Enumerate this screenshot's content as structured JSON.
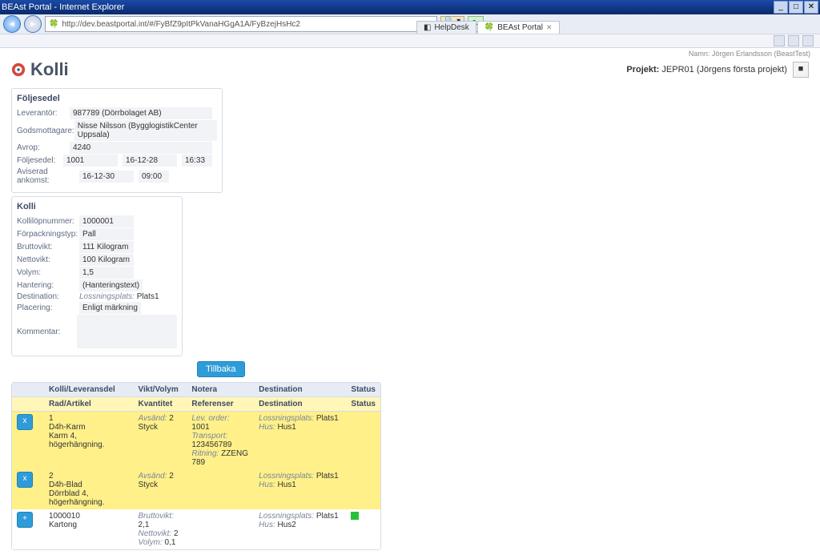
{
  "window": {
    "title": "BEAst Portal - Internet Explorer"
  },
  "url": "http://dev.beastportal.int/#/FyBfZ9pItPkVanaHGgA1A/FyBzejHsHc2",
  "tabs": [
    {
      "label": "HelpDesk",
      "active": false
    },
    {
      "label": "BEAst Portal",
      "active": true
    }
  ],
  "user_line": "Namn: Jörgen Erlandsson (BeastTest)",
  "page_title": "Kolli",
  "projekt_label": "Projekt:",
  "projekt_value": "JEPR01 (Jörgens första projekt)",
  "foljesedel": {
    "title": "Följesedel",
    "leverantor_label": "Leverantör:",
    "leverantor": "987789 (Dörrbolaget AB)",
    "godsmottagare_label": "Godsmottagare:",
    "godsmottagare": "Nisse Nilsson (BygglogistikCenter Uppsala)",
    "avrop_label": "Avrop:",
    "avrop": "4240",
    "foljesedel_label": "Följesedel:",
    "foljesedel": "1001",
    "foljesedel_date": "16-12-28",
    "foljesedel_time": "16:33",
    "aviserad_label": "Aviserad ankomst:",
    "aviserad_date": "16-12-30",
    "aviserad_time": "09:00"
  },
  "kolli": {
    "title": "Kolli",
    "kollilop_label": "Kollilöpnummer:",
    "kollilop": "1000001",
    "forpack_label": "Förpackningstyp:",
    "forpack": "Pall",
    "brutto_label": "Bruttovikt:",
    "brutto": "111 Kilogram",
    "netto_label": "Nettovikt:",
    "netto": "100 Kilogram",
    "volym_label": "Volym:",
    "volym": "1,5",
    "hantering_label": "Hantering:",
    "hantering": "(Hanteringstext)",
    "destination_label": "Destination:",
    "destination_prefix": "Lossningsplats:",
    "destination": "Plats1",
    "placering_label": "Placering:",
    "placering": "Enligt märkning",
    "kommentar_label": "Kommentar:"
  },
  "back_button": "Tillbaka",
  "table": {
    "headers1": [
      "",
      "Kolli/Leveransdel",
      "Vikt/Volym",
      "Notera",
      "Destination",
      "Status"
    ],
    "headers2": [
      "",
      "Rad/Artikel",
      "Kvantitet",
      "Referenser",
      "Destination",
      "Status"
    ],
    "rows": [
      {
        "type": "yellow",
        "btn": "x",
        "c1_line1": "1",
        "c1_line2": "D4h-Karm",
        "c1_line3": "Karm 4, högerhängning.",
        "c2_l1_label": "Avsänd:",
        "c2_l1_val": "2",
        "c2_l2": "Styck",
        "c3_l1_label": "Lev. order:",
        "c3_l1_val": "1001",
        "c3_l2_label": "Transport:",
        "c3_l2_val": "123456789",
        "c3_l3_label": "Ritning:",
        "c3_l3_val": "ZZENG 789",
        "c4_l1_label": "Lossningsplats:",
        "c4_l1_val": "Plats1",
        "c4_l2_label": "Hus:",
        "c4_l2_val": "Hus1"
      },
      {
        "type": "yellow",
        "btn": "x",
        "c1_line1": "2",
        "c1_line2": "D4h-Blad",
        "c1_line3": "Dörrblad 4, högerhängning.",
        "c2_l1_label": "Avsänd:",
        "c2_l1_val": "2",
        "c2_l2": "Styck",
        "c4_l1_label": "Lossningsplats:",
        "c4_l1_val": "Plats1",
        "c4_l2_label": "Hus:",
        "c4_l2_val": "Hus1"
      },
      {
        "type": "white",
        "btn": "+",
        "c1_line1": "1000010",
        "c1_line2": "Kartong",
        "c2_l1_label": "Bruttovikt:",
        "c2_l1_val": "2,1",
        "c2_l2_label": "Nettovikt:",
        "c2_l2_val": "2",
        "c2_l3_label": "Volym:",
        "c2_l3_val": "0,1",
        "c4_l1_label": "Lossningsplats:",
        "c4_l1_val": "Plats1",
        "c4_l2_label": "Hus:",
        "c4_l2_val": "Hus2",
        "status_square": true
      }
    ]
  }
}
